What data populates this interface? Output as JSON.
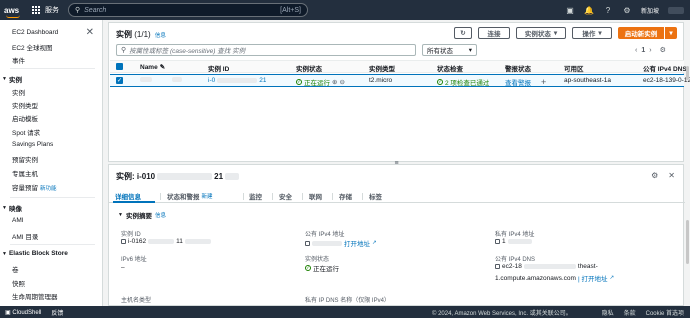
{
  "topbar": {
    "logo": "aws",
    "services": "服务",
    "search_placeholder": "Search",
    "search_shortcut": "[Alt+S]",
    "region": "新加坡"
  },
  "sidebar": {
    "items_top": [
      "EC2 Dashboard",
      "EC2 全球视图",
      "事件"
    ],
    "section_instances": "实例",
    "instances_items": [
      "实例",
      "实例类型",
      "启动模板",
      "Spot 请求",
      "Savings Plans",
      "预留实例",
      "专属主机"
    ],
    "capacity_item": "容量预留",
    "new_badge": "新功能",
    "section_images": "映像",
    "images_items": [
      "AMI",
      "AMI 目录"
    ],
    "section_ebs": "Elastic Block Store",
    "ebs_items": [
      "卷",
      "快照",
      "生命周期管理器"
    ]
  },
  "instances": {
    "title": "实例",
    "count": "(1/1)",
    "info": "信息",
    "connect": "连接",
    "instance_state": "实例状态",
    "actions": "操作",
    "launch": "启动新实例",
    "filter_placeholder": "按属性或标签 (case-sensitive) 查找 实例",
    "state_filter": "所有状态",
    "page": "1",
    "columns": [
      "Name",
      "实例 ID",
      "实例状态",
      "实例类型",
      "状态检查",
      "警报状态",
      "可用区",
      "公有 IPv4 DNS"
    ],
    "row": {
      "id_prefix": "i-0",
      "id_suffix": "21",
      "state": "正在运行",
      "type": "t2.micro",
      "checks": "2 项检查已通过",
      "alarm": "查看警报",
      "alarm_add": "+",
      "az": "ap-southeast-1a",
      "dns": "ec2-18-139-0-12"
    }
  },
  "detail": {
    "title_prefix": "实例: i-010",
    "title_suffix": "21",
    "tabs": [
      "详细信息",
      "状态和警报",
      "监控",
      "安全",
      "联网",
      "存储",
      "标签"
    ],
    "tab_new": "新建",
    "summary": "实例摘要",
    "info": "信息",
    "fields": {
      "instance_id_label": "实例 ID",
      "instance_id_value": "i-0162",
      "instance_id_tail": "11",
      "public_ip_label": "公有 IPv4 地址",
      "open_address": "打开地址",
      "private_ip_label": "私有 IPv4 地址",
      "private_ip_value": "1",
      "ipv6_label": "IPv6 地址",
      "ipv6_value": "–",
      "state_label": "实例状态",
      "state_value": "正在运行",
      "public_dns_label": "公有 IPv4 DNS",
      "public_dns_value_1": "ec2-18",
      "public_dns_value_1b": "theast-",
      "public_dns_value_2": "1.compute.amazonaws.com",
      "hostname_type_label": "主机名类型",
      "private_dns_label": "私有 IP DNS 名称（仅限 IPv4）"
    }
  },
  "footer": {
    "cloudshell": "CloudShell",
    "feedback": "反馈",
    "copyright": "© 2024, Amazon Web Services, Inc. 或其关联公司。",
    "privacy": "隐私",
    "terms": "条款",
    "cookies": "Cookie 首选项"
  },
  "colors": {
    "nav": "#232f3e",
    "accent": "#ec7211",
    "link": "#0073bb",
    "success": "#1d8102"
  }
}
